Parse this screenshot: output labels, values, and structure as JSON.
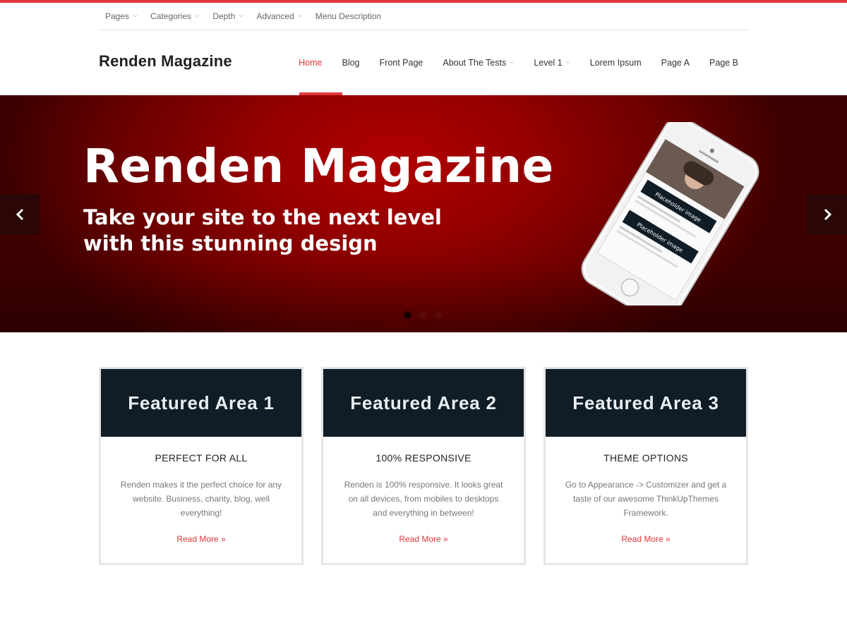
{
  "topbar": {
    "items": [
      {
        "label": "Pages",
        "caret": true
      },
      {
        "label": "Categories",
        "caret": true
      },
      {
        "label": "Depth",
        "caret": true
      },
      {
        "label": "Advanced",
        "caret": true
      },
      {
        "label": "Menu Description",
        "caret": false
      }
    ]
  },
  "header": {
    "logo": "Renden Magazine",
    "nav": [
      {
        "label": "Home",
        "active": true
      },
      {
        "label": "Blog"
      },
      {
        "label": "Front Page"
      },
      {
        "label": "About The Tests",
        "caret": true
      },
      {
        "label": "Level 1",
        "caret": true
      },
      {
        "label": "Lorem Ipsum"
      },
      {
        "label": "Page A"
      },
      {
        "label": "Page B"
      }
    ]
  },
  "slider": {
    "title": "Renden Magazine",
    "subtitle_line1": "Take your site to the next level",
    "subtitle_line2": "with this stunning design",
    "slide_count": 3,
    "active_slide": 1,
    "phone_placeholder_1": "Placeholder image",
    "phone_placeholder_2": "Placeholder image"
  },
  "features": [
    {
      "head": "Featured Area 1",
      "title": "PERFECT FOR ALL",
      "text": "Renden makes it the perfect choice for any website. Business, charity, blog, well everything!",
      "link": "Read More »"
    },
    {
      "head": "Featured Area 2",
      "title": "100% RESPONSIVE",
      "text": "Renden is 100% responsive. It looks great on all devices, from mobiles to desktops and everything in between!",
      "link": "Read More »"
    },
    {
      "head": "Featured Area 3",
      "title": "THEME OPTIONS",
      "text": "Go to Appearance -> Customizer and get a taste of our awesome ThinkUpThemes Framework.",
      "link": "Read More »"
    }
  ],
  "colors": {
    "accent": "#e0373b",
    "hero_red": "#b10000",
    "feature_head_bg": "#101c26"
  }
}
